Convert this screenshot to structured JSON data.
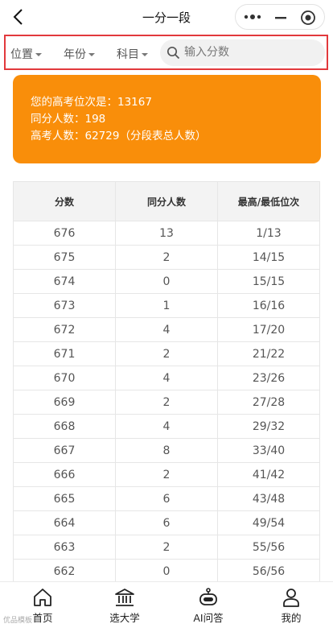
{
  "navbar": {
    "title": "一分一段",
    "back_icon": "chevron-left-icon",
    "capsule_icons": [
      "more-dots-icon",
      "minimize-icon",
      "close-target-icon"
    ]
  },
  "filters": {
    "location": "位置",
    "year": "年份",
    "subject": "科目",
    "search_placeholder": "输入分数",
    "search_value": ""
  },
  "summary": {
    "rank_line": "您的高考位次是：13167",
    "same_score_line": "同分人数：198",
    "total_line": "高考人数：62729（分段表总人数）",
    "card_color": "#f98e0a"
  },
  "table": {
    "headers": [
      "分数",
      "同分人数",
      "最高/最低位次"
    ],
    "rows": [
      [
        "676",
        "13",
        "1/13"
      ],
      [
        "675",
        "2",
        "14/15"
      ],
      [
        "674",
        "0",
        "15/15"
      ],
      [
        "673",
        "1",
        "16/16"
      ],
      [
        "672",
        "4",
        "17/20"
      ],
      [
        "671",
        "2",
        "21/22"
      ],
      [
        "670",
        "4",
        "23/26"
      ],
      [
        "669",
        "2",
        "27/28"
      ],
      [
        "668",
        "4",
        "29/32"
      ],
      [
        "667",
        "8",
        "33/40"
      ],
      [
        "666",
        "2",
        "41/42"
      ],
      [
        "665",
        "6",
        "43/48"
      ],
      [
        "664",
        "6",
        "49/54"
      ],
      [
        "663",
        "2",
        "55/56"
      ],
      [
        "662",
        "0",
        "56/56"
      ]
    ]
  },
  "tabbar": {
    "tabs": [
      {
        "label": "首页",
        "icon": "home-icon"
      },
      {
        "label": "选大学",
        "icon": "university-icon"
      },
      {
        "label": "AI问答",
        "icon": "robot-icon"
      },
      {
        "label": "我的",
        "icon": "user-icon"
      }
    ]
  },
  "accent": "#e2393c",
  "watermark": "优品模板"
}
